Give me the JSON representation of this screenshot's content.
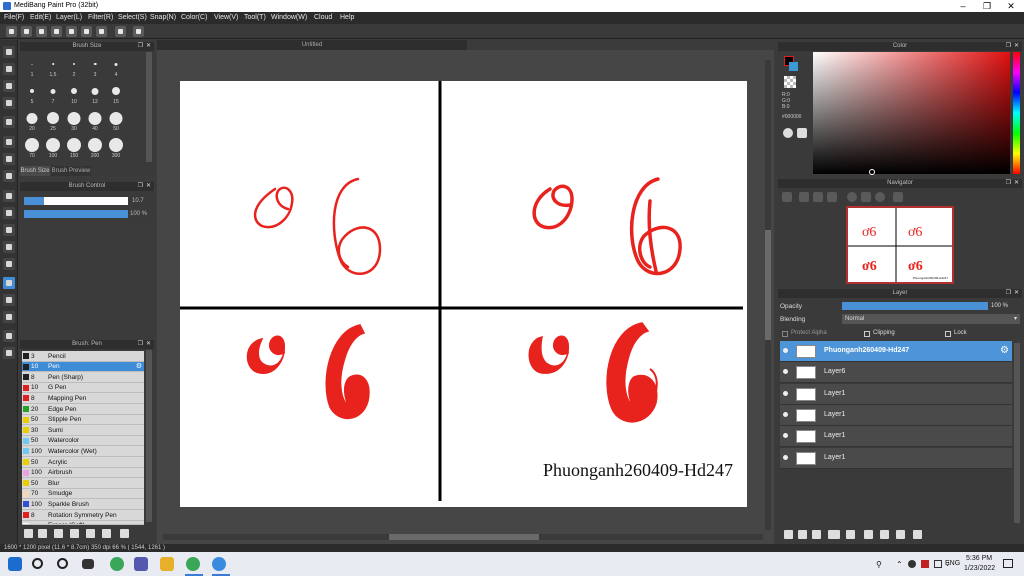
{
  "window": {
    "title": "MediBang Paint Pro (32bit)",
    "minimize": "–",
    "maximize": "❐",
    "close": "✕"
  },
  "menu": [
    "File(F)",
    "Edit(E)",
    "Layer(L)",
    "Filter(R)",
    "Select(S)",
    "Snap(N)",
    "Color(C)",
    "View(V)",
    "Tool(T)",
    "Window(W)",
    "Cloud",
    "Help"
  ],
  "document": {
    "tab_title": "Untitled"
  },
  "brush_size_panel": {
    "title": "Brush Size",
    "sizes": [
      "1",
      "1.5",
      "2",
      "3",
      "4",
      "5",
      "7",
      "10",
      "12",
      "15",
      "20",
      "25",
      "30",
      "40",
      "50",
      "70",
      "100",
      "150",
      "200",
      "300"
    ],
    "tabs": [
      "Brush Size",
      "Brush Preview"
    ]
  },
  "brush_control": {
    "title": "Brush Control",
    "size_value": "10.7",
    "opacity_value": "100 %"
  },
  "brush_list": {
    "title": "Brush: Pen",
    "items": [
      {
        "size": "3",
        "name": "Pencil",
        "color": "#222222"
      },
      {
        "size": "10",
        "name": "Pen",
        "color": "#222222"
      },
      {
        "size": "8",
        "name": "Pen (Sharp)",
        "color": "#222222"
      },
      {
        "size": "10",
        "name": "G Pen",
        "color": "#e02020"
      },
      {
        "size": "8",
        "name": "Mapping Pen",
        "color": "#e02020"
      },
      {
        "size": "20",
        "name": "Edge Pen",
        "color": "#27a327"
      },
      {
        "size": "50",
        "name": "Stipple Pen",
        "color": "#e8d000"
      },
      {
        "size": "30",
        "name": "Sumi",
        "color": "#e8d000"
      },
      {
        "size": "50",
        "name": "Watercolor",
        "color": "#6ec8f0"
      },
      {
        "size": "100",
        "name": "Watercolor (Wet)",
        "color": "#6ec8f0"
      },
      {
        "size": "50",
        "name": "Acrylic",
        "color": "#e8d000"
      },
      {
        "size": "100",
        "name": "Airbrush",
        "color": "#e8a0e0"
      },
      {
        "size": "50",
        "name": "Blur",
        "color": "#e8d000"
      },
      {
        "size": "70",
        "name": "Smudge",
        "color": "#f0d8b8"
      },
      {
        "size": "100",
        "name": "Sparkle Brush",
        "color": "#3050d0"
      },
      {
        "size": "8",
        "name": "Rotation Symmetry Pen",
        "color": "#e02020"
      },
      {
        "size": "",
        "name": "Eraser (Soft)",
        "color": "#ffffff"
      }
    ]
  },
  "canvas_text": "Phuonganh260409-Hd247",
  "color_panel": {
    "title": "Color",
    "r": "R:0",
    "g": "G:0",
    "b": "B:0",
    "hex": "#000000"
  },
  "navigator": {
    "title": "Navigator",
    "thumb_caption": "Phuonganh260409-Hd247"
  },
  "layer_panel": {
    "title": "Layer",
    "opacity_label": "Opacity",
    "opacity_value": "100 %",
    "blending_label": "Blending",
    "blending_value": "Normal",
    "protect_alpha": "Protect Alpha",
    "clipping": "Clipping",
    "lock": "Lock",
    "layers": [
      "Phuonganh260409-Hd247",
      "Layer6",
      "Layer1",
      "Layer1",
      "Layer1",
      "Layer1"
    ]
  },
  "status_bar": {
    "text": "1600 * 1200 pixel   (11.6 * 8.7cm)   350 dpi   66 %   ( 1544, 1261 )"
  },
  "taskbar": {
    "lang": "ENG",
    "time": "5:36 PM",
    "date": "1/23/2022"
  },
  "colors": {
    "accent": "#3e8bd6",
    "ink": "#e8231e"
  }
}
